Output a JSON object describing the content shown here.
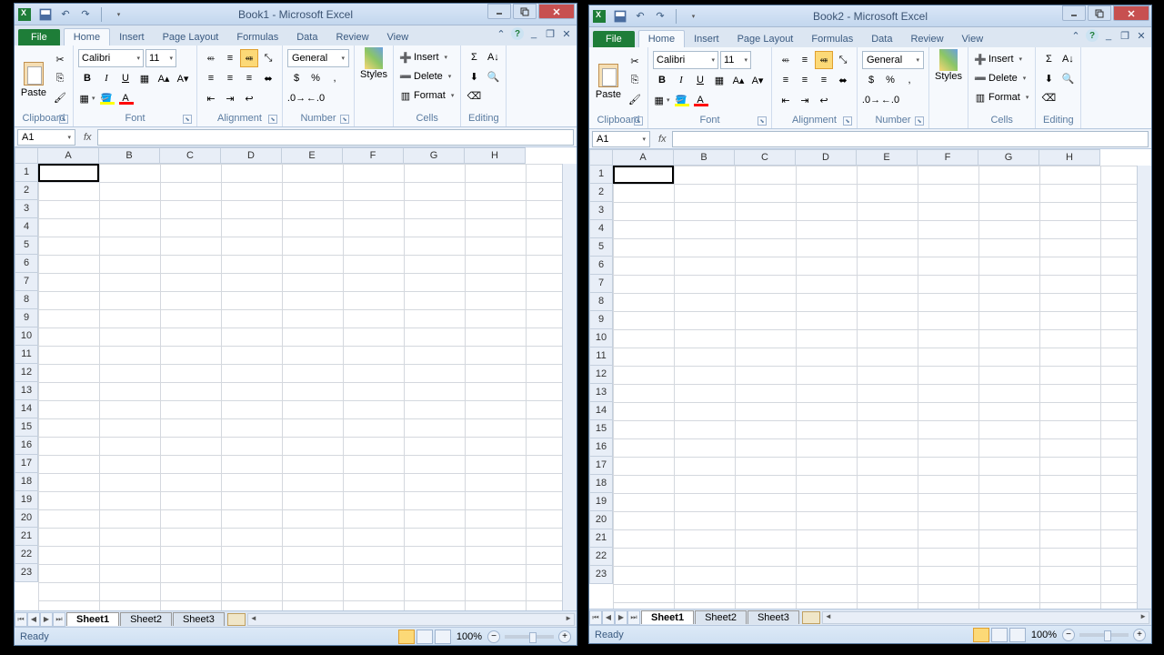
{
  "app_name": "Microsoft Excel",
  "windows": [
    {
      "book": "Book1",
      "title": "Book1 - Microsoft Excel"
    },
    {
      "book": "Book2",
      "title": "Book2 - Microsoft Excel"
    }
  ],
  "tabs": {
    "file": "File",
    "list": [
      "Home",
      "Insert",
      "Page Layout",
      "Formulas",
      "Data",
      "Review",
      "View"
    ],
    "active": "Home"
  },
  "ribbon": {
    "clipboard": {
      "paste": "Paste",
      "label": "Clipboard"
    },
    "font": {
      "name": "Calibri",
      "size": "11",
      "label": "Font"
    },
    "alignment": {
      "label": "Alignment"
    },
    "number": {
      "format": "General",
      "label": "Number"
    },
    "styles": {
      "btn": "Styles",
      "label": "Styles"
    },
    "cells": {
      "insert": "Insert",
      "delete": "Delete",
      "format": "Format",
      "label": "Cells"
    },
    "editing": {
      "label": "Editing"
    }
  },
  "namebox": "A1",
  "columns": [
    "A",
    "B",
    "C",
    "D",
    "E",
    "F",
    "G",
    "H"
  ],
  "rows": [
    "1",
    "2",
    "3",
    "4",
    "5",
    "6",
    "7",
    "8",
    "9",
    "10",
    "11",
    "12",
    "13",
    "14",
    "15",
    "16",
    "17",
    "18",
    "19",
    "20",
    "21",
    "22",
    "23"
  ],
  "sheets": [
    "Sheet1",
    "Sheet2",
    "Sheet3"
  ],
  "status": {
    "ready": "Ready",
    "zoom": "100%"
  }
}
